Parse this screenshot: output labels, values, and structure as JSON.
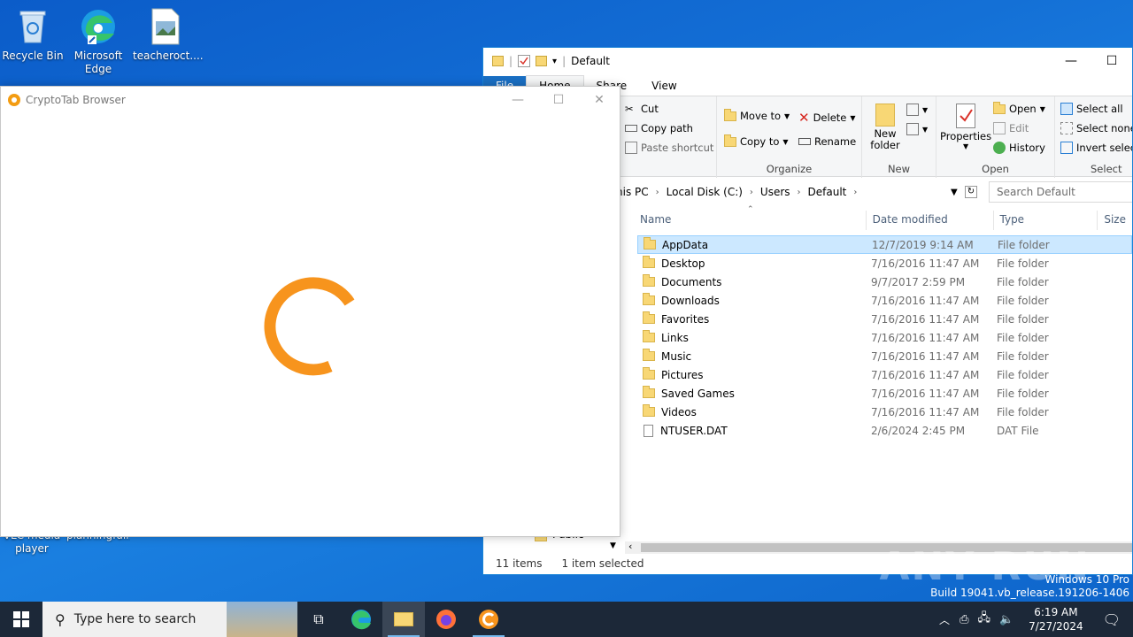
{
  "desktop": {
    "icons": [
      {
        "label": "Recycle Bin"
      },
      {
        "label": "Microsoft Edge"
      },
      {
        "label": "teacheroct...."
      },
      {
        "label": "VLC media player"
      },
      {
        "label": "planningfull..."
      }
    ]
  },
  "explorer": {
    "title": "Default",
    "tabs": [
      "File",
      "Home",
      "Share",
      "View"
    ],
    "clipboard": {
      "cut": "Cut",
      "copy_path": "Copy path",
      "paste_shortcut": "Paste shortcut"
    },
    "organize": {
      "label": "Organize",
      "move_to": "Move to",
      "copy_to": "Copy to",
      "delete": "Delete",
      "rename": "Rename"
    },
    "new": {
      "label": "New",
      "new_folder": "New folder"
    },
    "open": {
      "label": "Open",
      "properties": "Properties",
      "open": "Open",
      "edit": "Edit",
      "history": "History"
    },
    "select": {
      "label": "Select",
      "select_all": "Select all",
      "select_none": "Select none",
      "invert": "Invert selecti"
    },
    "breadcrumb": [
      "his PC",
      "Local Disk (C:)",
      "Users",
      "Default"
    ],
    "search_placeholder": "Search Default",
    "columns": [
      "Name",
      "Date modified",
      "Type",
      "Size"
    ],
    "files": [
      {
        "name": "AppData",
        "date": "12/7/2019 9:14 AM",
        "type": "File folder",
        "selected": true
      },
      {
        "name": "Desktop",
        "date": "7/16/2016 11:47 AM",
        "type": "File folder"
      },
      {
        "name": "Documents",
        "date": "9/7/2017 2:59 PM",
        "type": "File folder"
      },
      {
        "name": "Downloads",
        "date": "7/16/2016 11:47 AM",
        "type": "File folder"
      },
      {
        "name": "Favorites",
        "date": "7/16/2016 11:47 AM",
        "type": "File folder"
      },
      {
        "name": "Links",
        "date": "7/16/2016 11:47 AM",
        "type": "File folder"
      },
      {
        "name": "Music",
        "date": "7/16/2016 11:47 AM",
        "type": "File folder"
      },
      {
        "name": "Pictures",
        "date": "7/16/2016 11:47 AM",
        "type": "File folder"
      },
      {
        "name": "Saved Games",
        "date": "7/16/2016 11:47 AM",
        "type": "File folder"
      },
      {
        "name": "Videos",
        "date": "7/16/2016 11:47 AM",
        "type": "File folder"
      },
      {
        "name": "NTUSER.DAT",
        "date": "2/6/2024 2:45 PM",
        "type": "DAT File"
      }
    ],
    "nav_public": "Public",
    "status_items": "11 items",
    "status_selected": "1 item selected"
  },
  "crypto": {
    "title": "CryptoTab Browser",
    "accent": "#f7941d"
  },
  "taskbar": {
    "search_placeholder": "Type here to search",
    "time": "6:19 AM",
    "date": "7/27/2024"
  },
  "watermark": {
    "line1": "Windows 10 Pro",
    "line2": "Build 19041.vb_release.191206-1406",
    "brand": "ANY RUN"
  }
}
